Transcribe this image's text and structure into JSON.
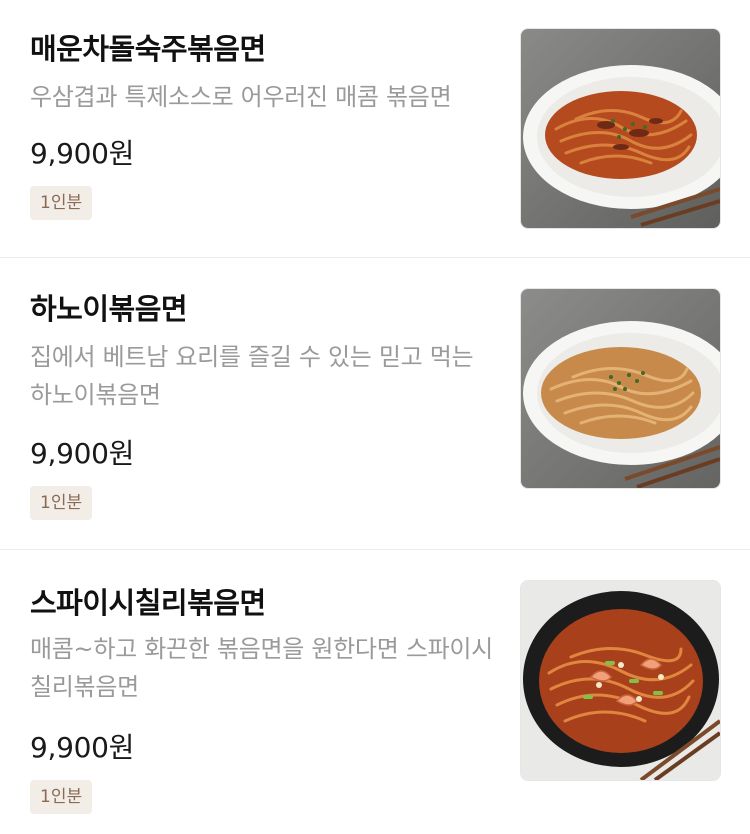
{
  "menu": {
    "items": [
      {
        "name": "매운차돌숙주볶음면",
        "description": "우삼겹과 특제소스로 어우러진 매콤 볶음면",
        "price": "9,900원",
        "badge": "1인분"
      },
      {
        "name": "하노이볶음면",
        "description": "집에서 베트남 요리를 즐길 수 있는 믿고 먹는 하노이볶음면",
        "price": "9,900원",
        "badge": "1인분"
      },
      {
        "name": "스파이시칠리볶음면",
        "description": "매콤~하고 화끈한 볶음면을 원한다면 스파이시칠리볶음면",
        "price": "9,900원",
        "badge": "1인분"
      }
    ]
  },
  "colors": {
    "name_text": "#111111",
    "description_text": "#9a9a9a",
    "price_text": "#1a1a1a",
    "badge_text": "#8a6a55",
    "badge_background": "#f3ede8",
    "divider": "#ececec"
  }
}
